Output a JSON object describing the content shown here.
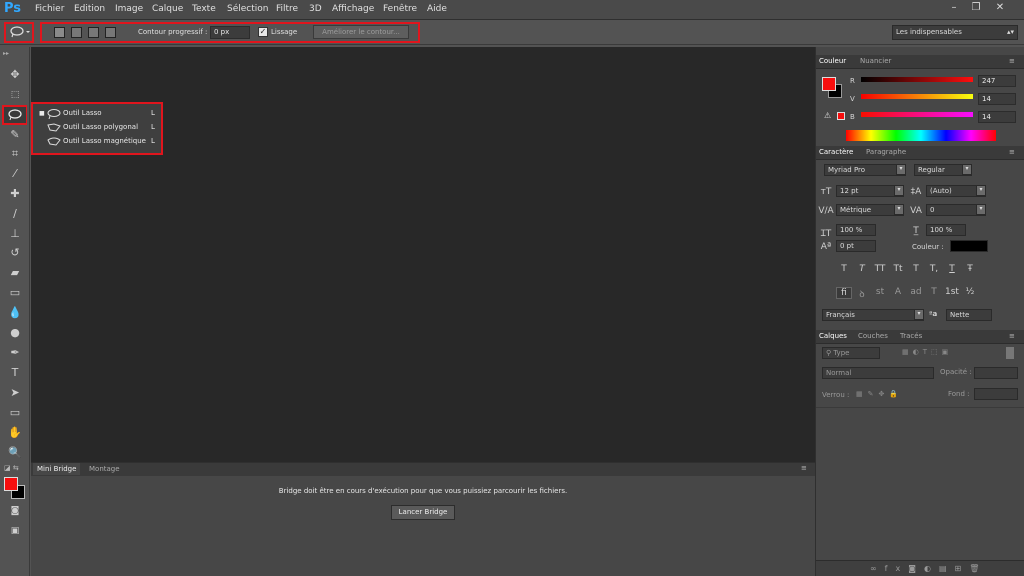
{
  "app": {
    "logo": "Ps"
  },
  "menu": [
    "Fichier",
    "Edition",
    "Image",
    "Calque",
    "Texte",
    "Sélection",
    "Filtre",
    "3D",
    "Affichage",
    "Fenêtre",
    "Aide"
  ],
  "window_buttons": [
    "–",
    "❐",
    "✕"
  ],
  "options": {
    "feather_label": "Contour progressif :",
    "feather_value": "0 px",
    "smooth_label": "Lissage",
    "refine_button": "Améliorer le contour...",
    "workspace": "Les indispensables"
  },
  "flyout": {
    "items": [
      {
        "label": "Outil Lasso",
        "key": "L"
      },
      {
        "label": "Outil Lasso polygonal",
        "key": "L"
      },
      {
        "label": "Outil Lasso magnétique",
        "key": "L"
      }
    ]
  },
  "bridge": {
    "tabs": [
      "Mini Bridge",
      "Montage"
    ],
    "message": "Bridge doit être en cours d'exécution pour que vous puissiez parcourir les fichiers.",
    "launch_button": "Lancer Bridge"
  },
  "color_panel": {
    "tabs": [
      "Couleur",
      "Nuancier"
    ],
    "r_label": "R",
    "g_label": "V",
    "b_label": "B",
    "r_value": "247",
    "g_value": "14",
    "b_value": "14",
    "foreground": "#f70e0e"
  },
  "char_panel": {
    "tabs": [
      "Caractère",
      "Paragraphe"
    ],
    "font": "Myriad Pro",
    "style": "Regular",
    "size": "12 pt",
    "leading": "(Auto)",
    "kerning": "Métrique",
    "tracking": "0",
    "vscale": "100 %",
    "hscale": "100 %",
    "baseline": "0 pt",
    "color_label": "Couleur :",
    "language": "Français",
    "aa_label": "a",
    "antialias": "Nette",
    "style_buttons": [
      "T",
      "T",
      "TT",
      "Tt",
      "T",
      "T,",
      "T",
      "Ŧ"
    ],
    "opentype_buttons": [
      "fi",
      "ꝺ",
      "st",
      "A",
      "ad",
      "T",
      "1st",
      "½"
    ]
  },
  "layers_panel": {
    "tabs": [
      "Calques",
      "Couches",
      "Tracés"
    ],
    "filter": "Type",
    "blend": "Normal",
    "opacity_label": "Opacité :",
    "lock_label": "Verrou :",
    "fill_label": "Fond :"
  }
}
